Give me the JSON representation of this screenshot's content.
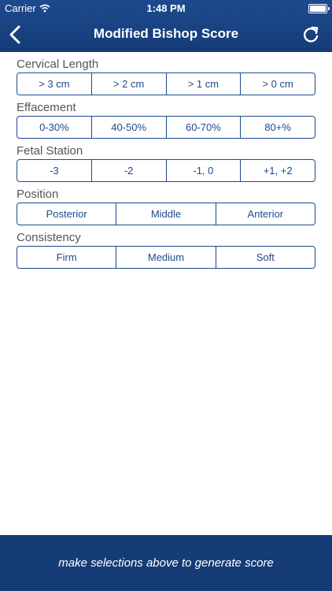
{
  "status_bar": {
    "carrier": "Carrier",
    "time": "1:48 PM"
  },
  "nav": {
    "title": "Modified Bishop Score",
    "back_icon": "chevron-left-icon",
    "refresh_icon": "refresh-icon"
  },
  "colors": {
    "accent": "#1d4a8e",
    "header_bg": "#153c77",
    "label_text": "#555555"
  },
  "sections": [
    {
      "label": "Cervical Length",
      "options": [
        "> 3 cm",
        "> 2 cm",
        "> 1 cm",
        "> 0 cm"
      ]
    },
    {
      "label": "Effacement",
      "options": [
        "0-30%",
        "40-50%",
        "60-70%",
        "80+%"
      ]
    },
    {
      "label": "Fetal Station",
      "options": [
        "-3",
        "-2",
        "-1, 0",
        "+1, +2"
      ]
    },
    {
      "label": "Position",
      "options": [
        "Posterior",
        "Middle",
        "Anterior"
      ]
    },
    {
      "label": "Consistency",
      "options": [
        "Firm",
        "Medium",
        "Soft"
      ]
    }
  ],
  "footer": {
    "message": "make selections above to generate score"
  }
}
